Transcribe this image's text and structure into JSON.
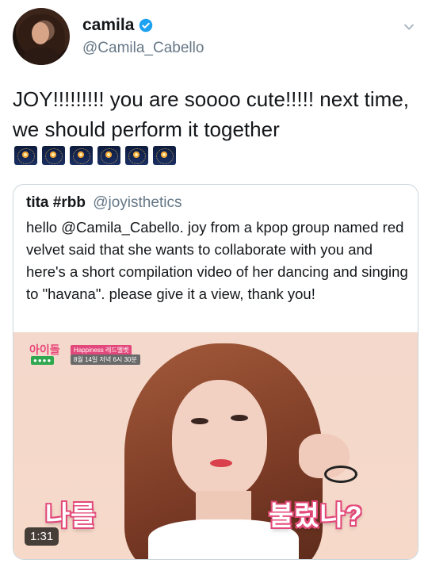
{
  "author": {
    "display_name": "camila",
    "handle": "@Camila_Cabello"
  },
  "tweet": {
    "text": "JOY!!!!!!!!! you are soooo cute!!!!! next time, we should perform it together",
    "emoji_icon": "fireworks-emoji",
    "emoji_count": 6
  },
  "quoted": {
    "display_name": "tita #rbb",
    "handle": "@joyisthetics",
    "text": "hello @Camila_Cabello. joy from a kpop group named red velvet said that she wants to collaborate with you and here's a short compilation video of her dancing and singing to \"havana\". please give it a view, thank you!",
    "media": {
      "caption_left": "나를",
      "caption_right": "불렀나?",
      "duration": "1:31",
      "show_logo": "아이돌",
      "logo_sub": "●●●●",
      "info_line1": "Happiness 레드벨벳",
      "info_line2": "8월 14일 저녁 6시 30분"
    }
  },
  "colors": {
    "verified_blue": "#1da1f2",
    "muted": "#657786",
    "border": "#ccd6dd"
  }
}
